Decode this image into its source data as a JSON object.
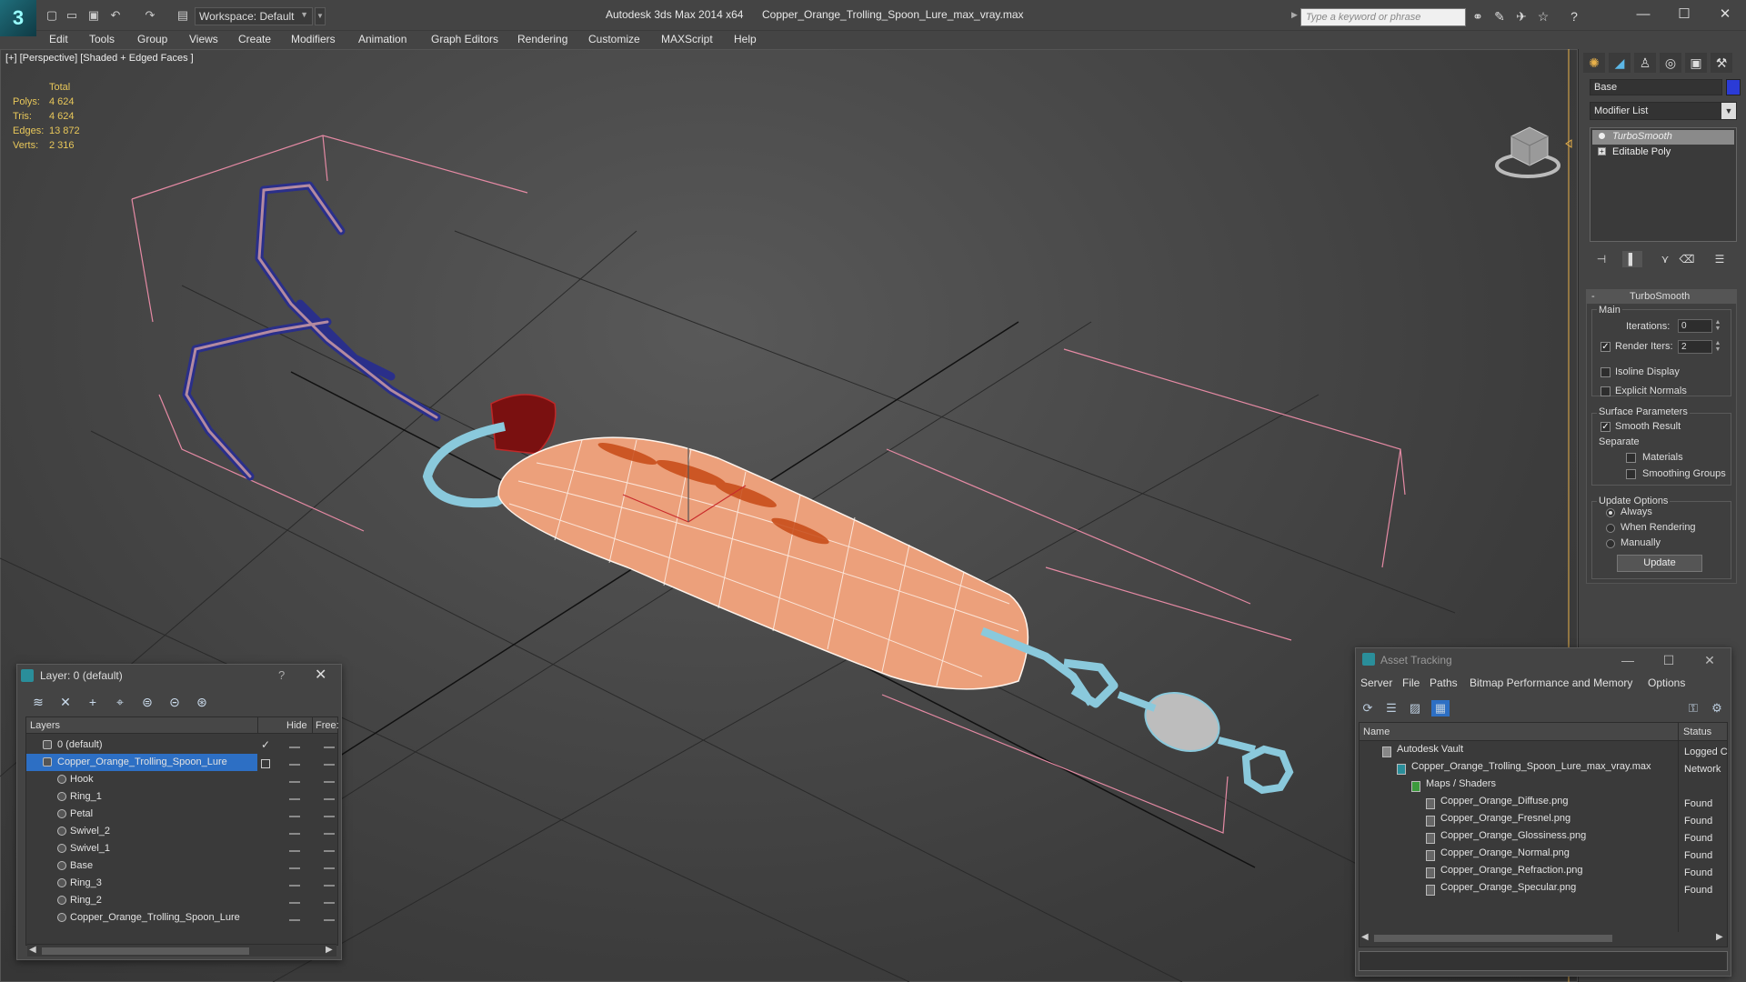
{
  "titlebar": {
    "app_title": "Autodesk 3ds Max  2014 x64",
    "file_title": "Copper_Orange_Trolling_Spoon_Lure_max_vray.max",
    "workspace": "Workspace: Default",
    "search_placeholder": "Type a keyword or phrase",
    "logo": "3"
  },
  "menu": [
    "Edit",
    "Tools",
    "Group",
    "Views",
    "Create",
    "Modifiers",
    "Animation",
    "Graph Editors",
    "Rendering",
    "Customize",
    "MAXScript",
    "Help"
  ],
  "viewport": {
    "label": "[+] [Perspective] [Shaded + Edged Faces ]",
    "stats": {
      "header": "Total",
      "polys_label": "Polys:",
      "polys": "4 624",
      "tris_label": "Tris:",
      "tris": "4 624",
      "edges_label": "Edges:",
      "edges": "13 872",
      "verts_label": "Verts:",
      "verts": "2 316"
    }
  },
  "command_panel": {
    "object_name": "Base",
    "object_color": "#2b3bd6",
    "modifier_list": "Modifier List",
    "stack": [
      "TurboSmooth",
      "Editable Poly"
    ],
    "turbosmooth": {
      "title": "TurboSmooth",
      "main": "Main",
      "iterations_label": "Iterations:",
      "iterations": "0",
      "render_iters_label": "Render Iters:",
      "render_iters": "2",
      "isoline": "Isoline Display",
      "explicit_normals": "Explicit Normals",
      "surface_params": "Surface Parameters",
      "smooth_result": "Smooth Result",
      "separate": "Separate",
      "materials": "Materials",
      "smoothing_groups": "Smoothing Groups",
      "update_options": "Update Options",
      "always": "Always",
      "when_rendering": "When Rendering",
      "manually": "Manually",
      "update": "Update"
    }
  },
  "layer_dialog": {
    "title": "Layer: 0 (default)",
    "help": "?",
    "col_layers": "Layers",
    "col_hide": "Hide",
    "col_freeze": "Free:",
    "rows": [
      {
        "name": "0 (default)"
      },
      {
        "name": "Copper_Orange_Trolling_Spoon_Lure"
      },
      {
        "name": "Hook"
      },
      {
        "name": "Ring_1"
      },
      {
        "name": "Petal"
      },
      {
        "name": "Swivel_2"
      },
      {
        "name": "Swivel_1"
      },
      {
        "name": "Base"
      },
      {
        "name": "Ring_3"
      },
      {
        "name": "Ring_2"
      },
      {
        "name": "Copper_Orange_Trolling_Spoon_Lure"
      }
    ]
  },
  "asset_tracking": {
    "title": "Asset Tracking",
    "menu": [
      "Server",
      "File",
      "Paths",
      "Bitmap Performance and Memory",
      "Options"
    ],
    "col_name": "Name",
    "col_status": "Status",
    "rows": [
      {
        "name": "Autodesk Vault",
        "status": "Logged C"
      },
      {
        "name": "Copper_Orange_Trolling_Spoon_Lure_max_vray.max",
        "status": "Network"
      },
      {
        "name": "Maps / Shaders",
        "status": ""
      },
      {
        "name": "Copper_Orange_Diffuse.png",
        "status": "Found"
      },
      {
        "name": "Copper_Orange_Fresnel.png",
        "status": "Found"
      },
      {
        "name": "Copper_Orange_Glossiness.png",
        "status": "Found"
      },
      {
        "name": "Copper_Orange_Normal.png",
        "status": "Found"
      },
      {
        "name": "Copper_Orange_Refraction.png",
        "status": "Found"
      },
      {
        "name": "Copper_Orange_Specular.png",
        "status": "Found"
      }
    ]
  }
}
